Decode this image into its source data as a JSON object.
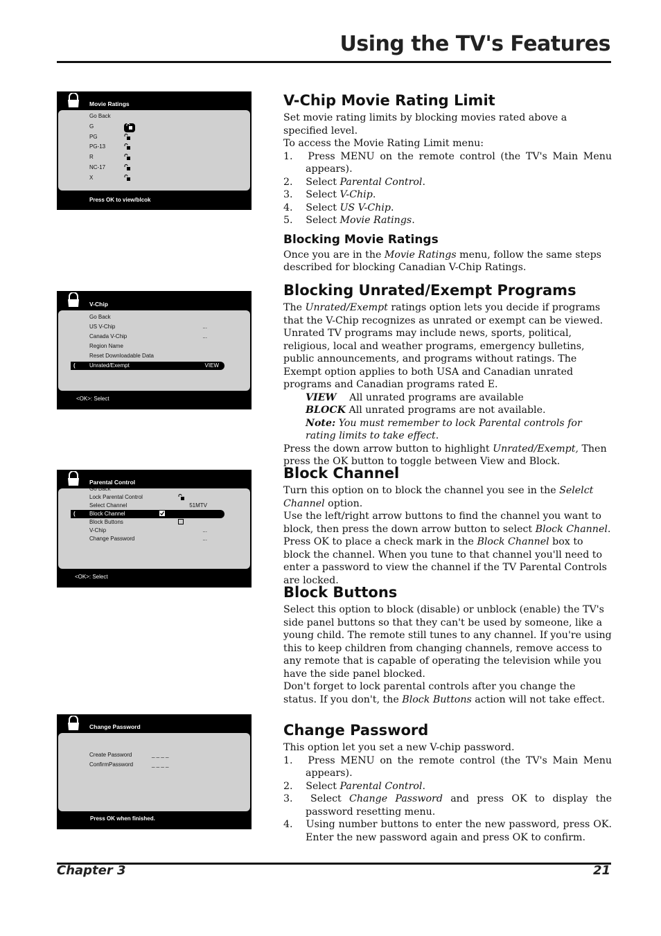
{
  "header": {
    "title": "Using the TV's Features"
  },
  "footer": {
    "chapter": "Chapter 3",
    "page": "21"
  },
  "screens": [
    {
      "title": "Movie Ratings",
      "footer": "Press OK to view/blcok",
      "rows": [
        {
          "label": "Go Back"
        },
        {
          "label": "G",
          "icon": "lock-open-icon",
          "highlight_icon": true
        },
        {
          "label": "PG",
          "icon": "lock-open-icon"
        },
        {
          "label": "PG-13",
          "icon": "lock-open-icon"
        },
        {
          "label": "R",
          "icon": "lock-open-icon"
        },
        {
          "label": "NC-17",
          "icon": "lock-open-icon"
        },
        {
          "label": "X",
          "icon": "lock-open-icon"
        }
      ]
    },
    {
      "title": "V-Chip",
      "footer": "<OK>: Select",
      "rows": [
        {
          "label": "Go Back"
        },
        {
          "label": "US V-Chip",
          "value": "..."
        },
        {
          "label": "Canada V-Chip",
          "value": "..."
        },
        {
          "label": "Region Name"
        },
        {
          "label": "Reset Downloadable Data"
        },
        {
          "label": "Unrated/Exempt",
          "value": "VIEW",
          "selected": true
        }
      ]
    },
    {
      "title": "Parental Control",
      "footer": "<OK>: Select",
      "rows": [
        {
          "label": "Go Back"
        },
        {
          "label": "Lock Parental Control",
          "icon": "lock-open-icon"
        },
        {
          "label": "Select Channel",
          "value": "51MTV"
        },
        {
          "label": "Block Channel",
          "icon": "checkbox-checked-icon",
          "selected": true
        },
        {
          "label": "Block Buttons",
          "icon": "checkbox-empty-icon"
        },
        {
          "label": "V-Chip",
          "value": "..."
        },
        {
          "label": "Change Password",
          "value": "..."
        }
      ]
    },
    {
      "title": "Change Password",
      "footer": "Press OK when finished.",
      "rows": [
        {
          "label": "Create Password",
          "value": "_ _ _ _"
        },
        {
          "label": "ConfirmPassword",
          "value": "_ _ _ _"
        }
      ]
    }
  ],
  "sections": [
    {
      "heading": "V-Chip Movie Rating Limit",
      "paras": [
        {
          "style": "",
          "runs": [
            "Set movie rating limits by blocking movies rated above a specified level."
          ]
        },
        {
          "style": "",
          "runs": [
            "To access the Movie Rating Limit menu:"
          ]
        },
        {
          "style": "ind",
          "runs": [
            "1.  Press MENU on the remote control (the TV's Main Menu appears)."
          ]
        },
        {
          "style": "ind",
          "runs": [
            "2.  Select ",
            {
              "i": "Parental Control"
            },
            "."
          ]
        },
        {
          "style": "ind",
          "runs": [
            "3.  Select ",
            {
              "i": "V-Chip"
            },
            "."
          ]
        },
        {
          "style": "ind",
          "runs": [
            "4.  Select ",
            {
              "i": "US V-Chip"
            },
            "."
          ]
        },
        {
          "style": "ind",
          "runs": [
            "5.  Select ",
            {
              "i": "Movie Ratings"
            },
            "."
          ]
        }
      ],
      "sub": {
        "heading": "Blocking Movie Ratings",
        "paras": [
          {
            "style": "",
            "runs": [
              "Once you are in the ",
              {
                "i": "Movie Ratings"
              },
              " menu, follow the same steps described for blocking Canadian V-Chip Ratings."
            ]
          }
        ]
      }
    },
    {
      "heading": "Blocking Unrated/Exempt Programs",
      "paras": [
        {
          "style": "",
          "runs": [
            "The ",
            {
              "i": "Unrated/Exempt"
            },
            " ratings option lets you decide if programs that the V-Chip recognizes as unrated or exempt can be viewed. Unrated TV programs may include news, sports, political, religious, local and weather programs, emergency bulletins, public announcements, and programs without ratings. The Exempt option applies to both USA and Canadian unrated programs and Canadian programs rated E."
          ]
        },
        {
          "style": "sub",
          "runs": [
            {
              "b": "VIEW"
            },
            "  All unrated programs are available"
          ]
        },
        {
          "style": "sub",
          "runs": [
            {
              "b": "BLOCK"
            },
            "  All unrated programs are not available."
          ]
        },
        {
          "style": "sub",
          "runs": [
            {
              "b": "Note:"
            },
            {
              "i": " You must remember to lock Parental controls for rating limits to take effect"
            },
            "."
          ]
        },
        {
          "style": "",
          "runs": [
            "Press the down arrow button to highlight ",
            {
              "i": "Unrated/Exempt,"
            },
            " Then press the OK button to toggle between View and Block."
          ]
        }
      ]
    },
    {
      "heading": "Block Channel",
      "paras": [
        {
          "style": "",
          "runs": [
            "Turn this option on to block the channel you see in the ",
            {
              "i": "Selelct Channel"
            },
            " option."
          ]
        },
        {
          "style": "",
          "runs": [
            "Use the  left/right arrow buttons to find the channel you want to block, then press the down arrow button to select ",
            {
              "i": "Block Channel"
            },
            ". Press OK to place a check mark in the ",
            {
              "i": "Block Channel"
            },
            " box to block the channel. When you tune to that channel you'll need to enter a password to view the channel if the TV Parental Controls are locked."
          ]
        }
      ]
    },
    {
      "heading": "Block Buttons",
      "paras": [
        {
          "style": "",
          "runs": [
            "Select this option to block (disable) or unblock (enable) the TV's side panel buttons so that they can't be used by someone, like a young child. The remote still tunes to any channel. If you're using this to keep children from changing channels, remove access to any remote that is capable of operating the television while you have the side panel blocked."
          ]
        },
        {
          "style": "",
          "runs": [
            "Don't forget to lock parental controls after you change the status. If you don't, the ",
            {
              "i": "Block Buttons"
            },
            " action will not take effect."
          ]
        }
      ]
    },
    {
      "heading": "Change Password",
      "paras": [
        {
          "style": "",
          "runs": [
            "This option let you set a new V-chip password."
          ]
        },
        {
          "style": "ind",
          "runs": [
            "1.  Press MENU on the remote control (the TV's Main Menu appears)."
          ]
        },
        {
          "style": "ind",
          "runs": [
            "2.  Select ",
            {
              "i": "Parental Control"
            },
            "."
          ]
        },
        {
          "style": "ind",
          "runs": [
            "3.  Select ",
            {
              "i": "Change Password"
            },
            " and press OK to display the password resetting menu."
          ]
        },
        {
          "style": "ind",
          "runs": [
            "4.  Using number buttons to enter the new password, press OK. Enter the new  password again and press OK to confirm."
          ]
        }
      ]
    }
  ]
}
